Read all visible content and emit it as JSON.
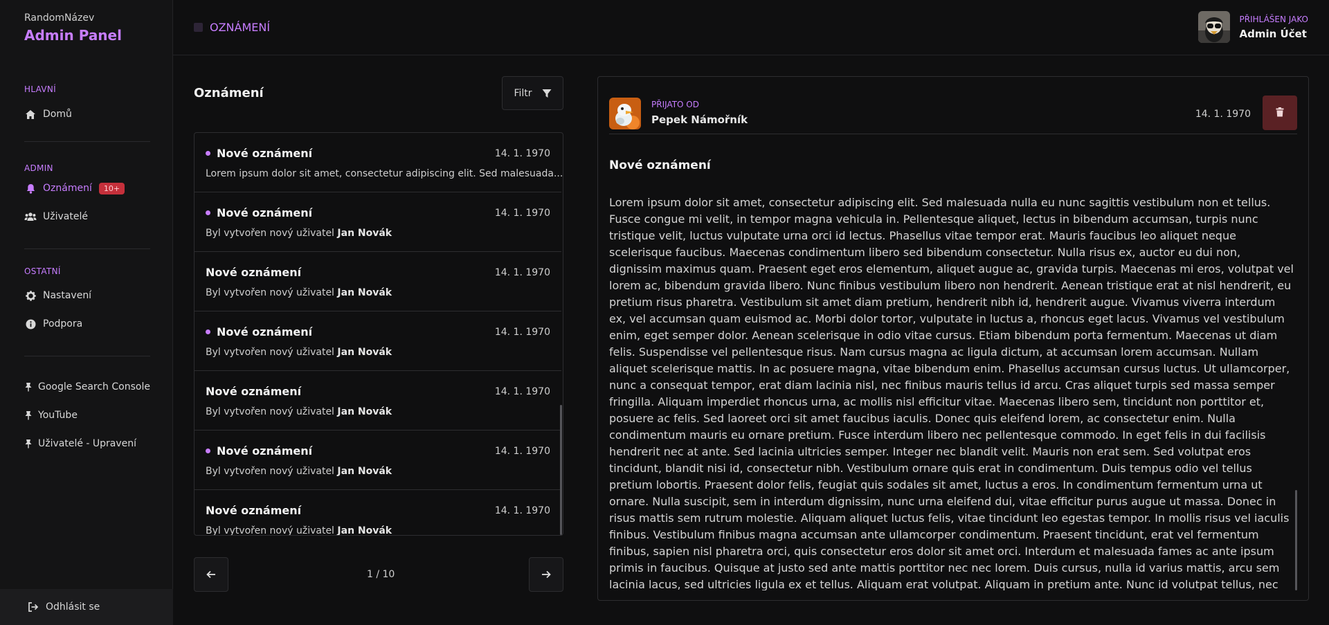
{
  "sidebar": {
    "brand_small": "RandomNázev",
    "brand_title": "Admin Panel",
    "sections": {
      "main": "HLAVNÍ",
      "admin": "ADMIN",
      "other": "OSTATNÍ"
    },
    "items": {
      "home": "Domů",
      "notifications": "Oznámení",
      "notifications_badge": "10+",
      "users": "Uživatelé",
      "settings": "Nastavení",
      "support": "Podpora"
    },
    "pinned": [
      "Google Search Console",
      "YouTube",
      "Uživatelé - Upravení"
    ],
    "logout": "Odhlásit se"
  },
  "topbar": {
    "breadcrumb": "OZNÁMENÍ",
    "user_label": "PŘIHLÁŠEN JAKO",
    "user_name": "Admin Účet"
  },
  "list": {
    "title": "Oznámení",
    "filter_label": "Filtr",
    "items": [
      {
        "title": "Nové oznámení",
        "date": "14. 1. 1970",
        "unread": true,
        "body": "Lorem ipsum dolor sit amet, consectetur adipiscing elit. Sed malesuada...",
        "body_prefix": "",
        "body_bold": ""
      },
      {
        "title": "Nové oznámení",
        "date": "14. 1. 1970",
        "unread": true,
        "body": "",
        "body_prefix": "Byl vytvořen nový uživatel",
        "body_bold": "Jan Novák"
      },
      {
        "title": "Nové oznámení",
        "date": "14. 1. 1970",
        "unread": false,
        "body": "",
        "body_prefix": "Byl vytvořen nový uživatel",
        "body_bold": "Jan Novák"
      },
      {
        "title": "Nové oznámení",
        "date": "14. 1. 1970",
        "unread": true,
        "body": "",
        "body_prefix": "Byl vytvořen nový uživatel",
        "body_bold": "Jan Novák"
      },
      {
        "title": "Nové oznámení",
        "date": "14. 1. 1970",
        "unread": false,
        "body": "",
        "body_prefix": "Byl vytvořen nový uživatel",
        "body_bold": "Jan Novák"
      },
      {
        "title": "Nové oznámení",
        "date": "14. 1. 1970",
        "unread": true,
        "body": "",
        "body_prefix": "Byl vytvořen nový uživatel",
        "body_bold": "Jan Novák"
      },
      {
        "title": "Nové oznámení",
        "date": "14. 1. 1970",
        "unread": false,
        "body": "",
        "body_prefix": "Byl vytvořen nový uživatel",
        "body_bold": "Jan Novák"
      }
    ],
    "pagination": "1 / 10"
  },
  "detail": {
    "sender_label": "PŘIJATO OD",
    "sender_name": "Pepek Námořník",
    "date": "14. 1. 1970",
    "title": "Nové oznámení",
    "body": "Lorem ipsum dolor sit amet, consectetur adipiscing elit. Sed malesuada nulla eu nunc sagittis vestibulum non et tellus. Fusce congue mi velit, in tempor magna vehicula in. Pellentesque aliquet, lectus in bibendum accumsan, turpis nunc tristique velit, luctus vulputate urna orci id lectus. Phasellus vitae tempor erat. Mauris faucibus leo aliquet neque scelerisque faucibus. Maecenas condimentum libero sed bibendum consectetur. Nulla risus ex, auctor eu dui non, dignissim maximus quam. Praesent eget eros elementum, aliquet augue ac, gravida turpis. Maecenas mi eros, volutpat vel lorem ac, bibendum gravida libero. Nunc finibus vestibulum libero non hendrerit. Aenean tristique erat at nisl hendrerit, eu pretium risus pharetra. Vestibulum sit amet diam pretium, hendrerit nibh id, hendrerit augue. Vivamus viverra interdum ex, vel accumsan quam euismod ac. Morbi dolor tortor, vulputate in luctus a, rhoncus eget lacus. Vivamus vel vestibulum enim, eget semper dolor. Aenean scelerisque in odio vitae cursus. Etiam bibendum porta fermentum. Maecenas ut diam felis. Suspendisse vel pellentesque risus. Nam cursus magna ac ligula dictum, at accumsan lorem accumsan. Nullam aliquet scelerisque mattis. In ac posuere magna, vitae bibendum enim. Phasellus accumsan cursus luctus. Ut ullamcorper, nunc a consequat tempor, erat diam lacinia nisl, nec finibus mauris tellus id arcu. Cras aliquet turpis sed massa semper fringilla. Aliquam imperdiet rhoncus urna, ac mollis nisl efficitur vitae. Maecenas libero sem, tincidunt non porttitor et, posuere ac felis. Sed laoreet orci sit amet faucibus iaculis. Donec quis eleifend lorem, ac consectetur enim. Nulla condimentum mauris eu ornare pretium. Fusce interdum libero nec pellentesque commodo. In eget felis in dui facilisis hendrerit nec at ante. Sed lacinia ultricies semper. Integer nec blandit velit. Mauris non erat sem. Sed volutpat eros tincidunt, blandit nisi id, consectetur nibh. Vestibulum ornare quis erat in condimentum. Duis tempus odio vel tellus pretium lobortis. Praesent dolor felis, feugiat quis sodales sit amet, luctus a eros. In condimentum fermentum urna ut ornare. Nulla suscipit, sem in interdum dignissim, nunc urna eleifend dui, vitae efficitur purus augue ut massa. Donec in risus mattis sem rutrum molestie. Aliquam aliquet luctus felis, vitae tincidunt leo egestas tempor. In mollis risus vel iaculis finibus. Vestibulum finibus magna accumsan ante ullamcorper condimentum. Praesent tincidunt, erat vel fermentum finibus, sapien nisl pharetra orci, quis consectetur eros dolor sit amet orci. Interdum et malesuada fames ac ante ipsum primis in faucibus. Quisque at justo sed ante mattis porttitor nec nec lorem. Duis cursus, nulla id varius mattis, arcu sem lacinia lacus, sed ultricies ligula ex et tellus. Aliquam erat volutpat. Aliquam in pretium ante. Nunc id volutpat tellus, nec convallis orci. Nullam vitae molestie eros. Cras sit amet aliquet eros. Nunc egestas, lectus vitae lacinia sodales, lacus justo venenatis odio, a condimentum dolor massa ut sem."
  },
  "colors": {
    "accent": "#c77dff",
    "badge": "#c5303b",
    "delete": "#5a2124",
    "background": "#0f0f10"
  },
  "icons": {
    "home": "home-icon",
    "bell": "bell-icon",
    "users": "users-icon",
    "gear": "gear-icon",
    "info": "info-icon",
    "pin": "pin-icon",
    "logout": "logout-icon",
    "filter": "filter-icon",
    "arrow_left": "arrow-left-icon",
    "arrow_right": "arrow-right-icon",
    "trash": "trash-icon"
  }
}
